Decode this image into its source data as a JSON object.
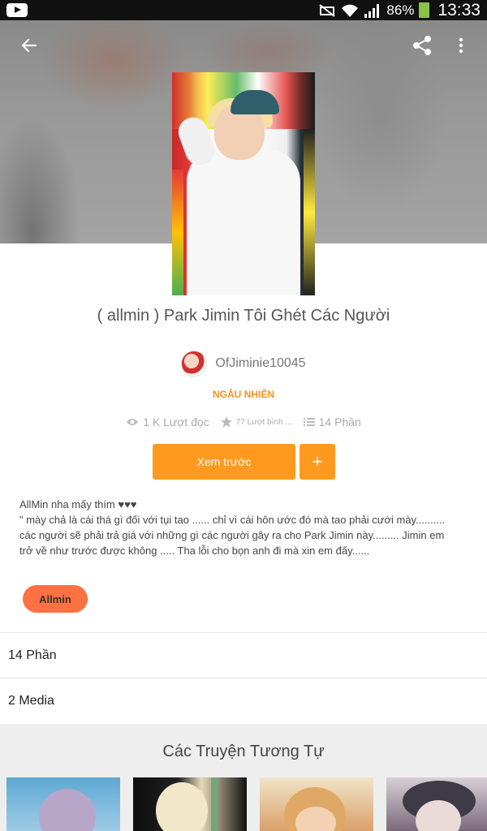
{
  "status_bar": {
    "battery_percent": "86%",
    "time": "13:33"
  },
  "story": {
    "title": "( allmin ) Park Jimin Tôi Ghét Các Người",
    "author": "OfJiminie10045",
    "category": "NGẪU NHIÊN",
    "reads": "1 K Lượt đọc",
    "votes": "77 Lượt bình ...",
    "parts": "14 Phần",
    "preview_label": "Xem trước",
    "add_label": "+",
    "description_lines": [
      "AllMin nha mấy thím ♥♥♥",
      "\" mày chả là cái thá gì đối với tụi tao ......  chỉ vì cái hôn ước đó mà tao phải cưới mày..........",
      "các người sẽ phải trả giá với những gì các người gây ra cho Park Jimin này......... Jimin em",
      "trở về như trước được không ..... Tha lỗi cho bọn anh đi mà xin em đấy......"
    ],
    "tag": "Allmin"
  },
  "sections": {
    "parts_row": "14 Phần",
    "media_row": "2 Media"
  },
  "similar": {
    "title": "Các Truyện Tương Tự"
  },
  "colors": {
    "accent": "#ff9a1e",
    "category": "#f7931e",
    "tag": "#ff7043",
    "battery": "#8bc34a"
  },
  "icons": [
    "youtube-icon",
    "wifi-icon",
    "signal-icon",
    "battery-icon",
    "back-arrow-icon",
    "share-icon",
    "more-vert-icon",
    "eye-icon",
    "star-icon",
    "list-icon",
    "plus-icon"
  ]
}
